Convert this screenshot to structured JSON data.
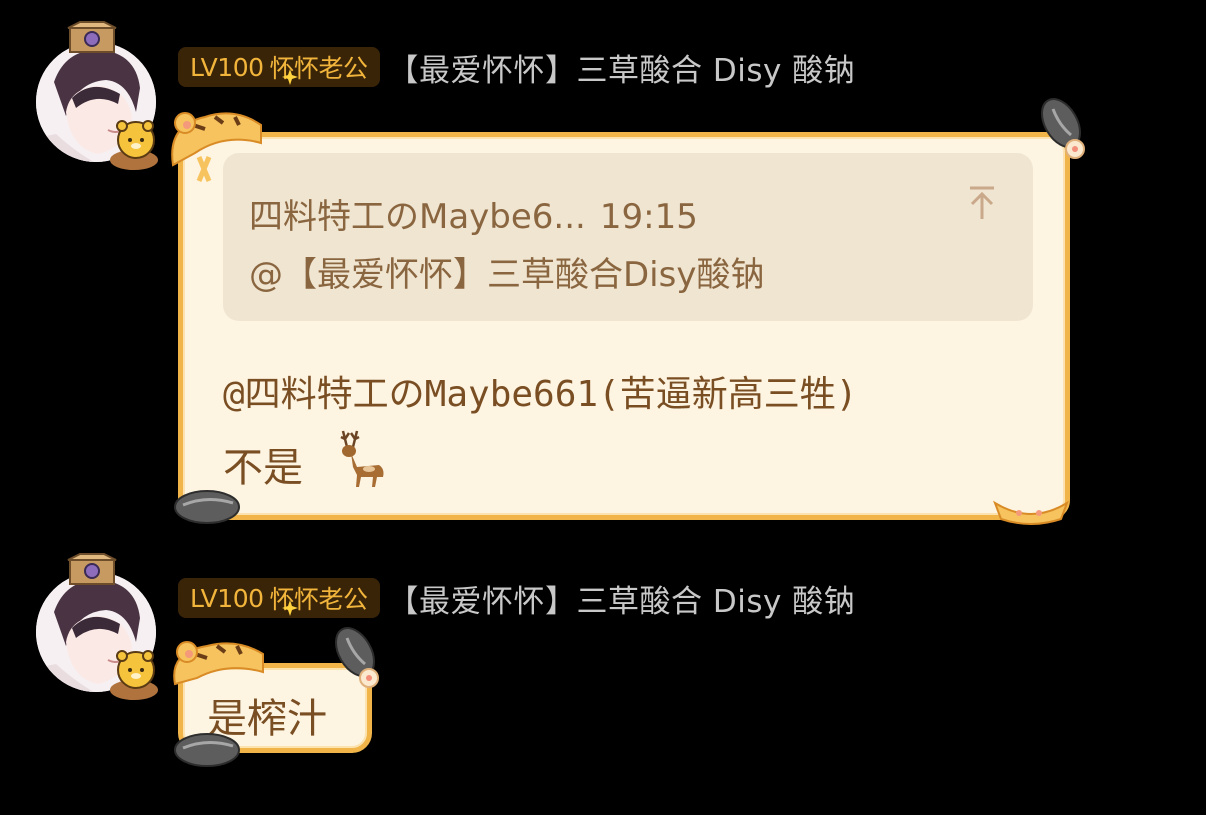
{
  "messages": [
    {
      "sender": {
        "level_badge": "LV100",
        "badge_title": "怀怀老公",
        "name": "【最爱怀怀】三草酸合 Disy 酸钠"
      },
      "quote": {
        "author": "四料特工のMaybe6...",
        "time": "19:15",
        "text": "@【最爱怀怀】三草酸合Disy酸钠"
      },
      "text_line1": "@四料特工のMaybe661(苦逼新高三牲)",
      "text_line2": "不是",
      "text_line2_emoji": "deer-emoji-icon"
    },
    {
      "sender": {
        "level_badge": "LV100",
        "badge_title": "怀怀老公",
        "name": "【最爱怀怀】三草酸合 Disy 酸钠"
      },
      "text": "是榨汁"
    }
  ],
  "colors": {
    "background": "#000000",
    "bubble_fill": "#fdf4e1",
    "bubble_border": "#f0b449",
    "quote_fill": "#f0e5d1",
    "quote_text": "#8a6640",
    "message_text": "#7a4e23",
    "badge_bg": "#3a2408",
    "badge_text": "#f2b53c",
    "sender_name": "#c8c8c8"
  }
}
